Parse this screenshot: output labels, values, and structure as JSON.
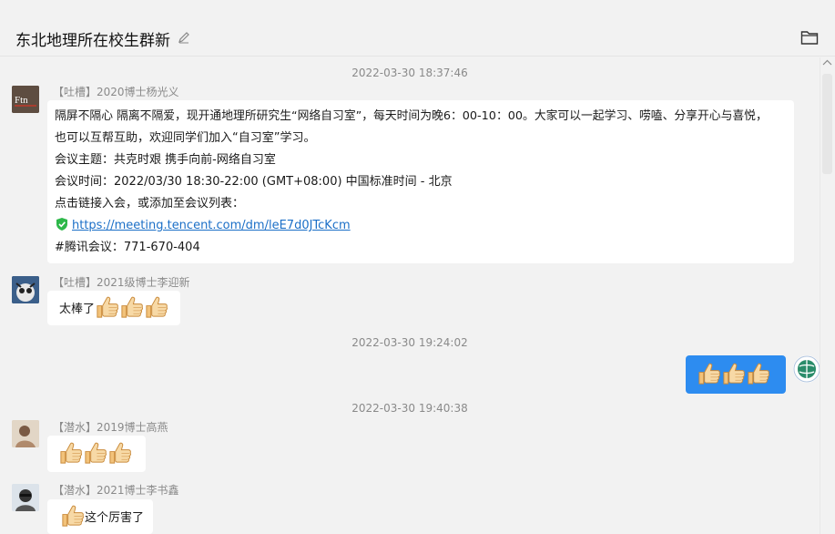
{
  "header": {
    "title": "东北地理所在校生群新"
  },
  "messages": {
    "t1": "2022-03-30 18:37:46",
    "m1": {
      "sender": "【吐槽】2020博士杨光义",
      "lines": [
        "隔屏不隔心 隔离不隔爱，现开通地理所研究生“网络自习室”，每天时间为晚6：00-10：00。大家可以一起学习、唠嗑、分享开心与喜悦，",
        "也可以互帮互助，欢迎同学们加入“自习室”学习。",
        "会议主题：共克时艰 携手向前-网络自习室",
        "会议时间：2022/03/30 18:30-22:00 (GMT+08:00) 中国标准时间 - 北京",
        "点击链接入会，或添加至会议列表：",
        "https://meeting.tencent.com/dm/leE7d0JTcKcm",
        "#腾讯会议：771-670-404"
      ]
    },
    "m2": {
      "sender": "【吐槽】2021级博士李迎新",
      "text": "太棒了"
    },
    "t2": "2022-03-30 19:24:02",
    "t3": "2022-03-30 19:40:38",
    "m4": {
      "sender": "【潜水】2019博士高燕"
    },
    "m5": {
      "sender": "【潜水】2021博士李书鑫",
      "text": "这个厉害了"
    }
  },
  "colors": {
    "outgoing_bubble": "#2d8cf0",
    "link": "#1b6fc7",
    "shield": "#2eb84a"
  },
  "icons": [
    "edit-icon",
    "folder-icon",
    "thumbs-up-icon",
    "shield-check-icon",
    "scroll-up-icon"
  ]
}
